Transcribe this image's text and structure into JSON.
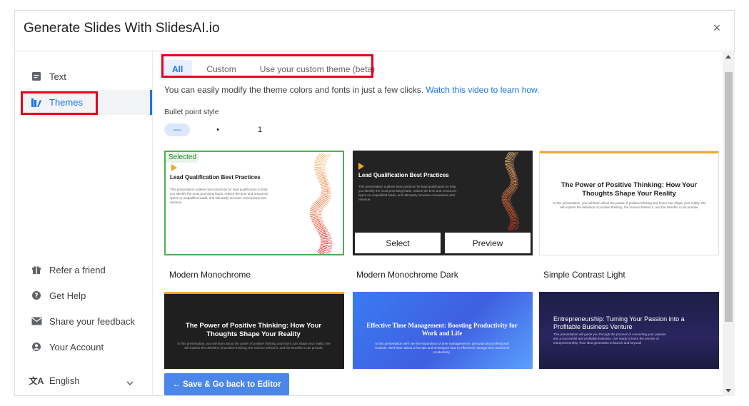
{
  "dialog": {
    "title": "Generate Slides With SlidesAI.io",
    "close_label": "×"
  },
  "sidebar": {
    "items": [
      {
        "label": "Text",
        "icon": "text-icon"
      },
      {
        "label": "Themes",
        "icon": "themes-icon"
      }
    ],
    "bottom": [
      {
        "label": "Refer a friend",
        "icon": "gift-icon"
      },
      {
        "label": "Get Help",
        "icon": "help-icon"
      },
      {
        "label": "Share your feedback",
        "icon": "mail-icon"
      },
      {
        "label": "Your Account",
        "icon": "account-icon"
      }
    ],
    "language": {
      "label": "English",
      "icon": "translate-icon"
    }
  },
  "tabs": [
    "All",
    "Custom",
    "Use your custom theme (beta)"
  ],
  "intro": {
    "text": "You can easily modify the theme colors and fonts in just a few clicks.",
    "link": "Watch this video to learn how."
  },
  "bullet": {
    "label": "Bullet point style",
    "options": [
      "—",
      "•",
      "1"
    ]
  },
  "cards": [
    {
      "name": "Modern Monochrome",
      "badge": "Selected",
      "heading": "Lead Qualification Best Practices",
      "body": "This presentation outlines best practices for lead qualification to help you identify the most promising leads, reduce the time and resources spent on unqualified leads, and ultimately increase conversions and revenue."
    },
    {
      "name": "Modern Monochrome Dark",
      "heading": "Lead Qualification Best Practices",
      "body": "This presentation outlines best practices for lead qualification to help you identify the most promising leads, reduce the time and resources spent on unqualified leads, and ultimately increase conversions and revenue.",
      "select_label": "Select",
      "preview_label": "Preview"
    },
    {
      "name": "Simple Contrast Light",
      "heading": "The Power of Positive Thinking: How Your Thoughts Shape Your Reality",
      "body": "In this presentation, you will learn about the power of positive thinking and how it can shape your reality. We will explore the definition of positive thinking, the science behind it, and the benefits it can provide."
    },
    {
      "heading": "The Power of Positive Thinking: How Your Thoughts Shape Your Reality",
      "body": "In this presentation, you will learn about the power of positive thinking and how it can shape your reality. We will explore the definition of positive thinking, the science behind it, and the benefits it can provide."
    },
    {
      "heading": "Effective Time Management: Boosting Productivity for Work and Life",
      "body": "In this presentation we'll see the importance of time management in personal and professional contexts. We'll learn about a few tips and techniques how to effectively manage time and boost productivity."
    },
    {
      "heading": "Entrepreneurship: Turning Your Passion into a Profitable Business Venture",
      "body": "This presentation will guide you through the process of converting your passion into a successful and profitable business. Get ready to learn the secrets of entrepreneurship, from idea generation to launch and beyond!"
    }
  ],
  "save_button": "← Save & Go back to Editor",
  "colors": {
    "accent": "#1a73e8",
    "highlight": "#e4001b",
    "selected": "#4caf50",
    "orange": "#f4a62a",
    "button": "#4b86ea"
  }
}
